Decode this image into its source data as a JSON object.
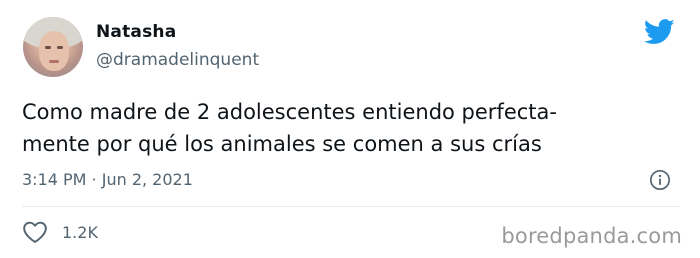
{
  "user": {
    "display_name": "Natasha",
    "handle": "@dramadelinquent",
    "avatar_icon": "profile-photo"
  },
  "tweet": {
    "text_lines": [
      "Como madre de 2 adolescentes entiendo perfecta-",
      "mente por qué los animales se comen a sus crías"
    ],
    "timestamp": "3:14 PM · Jun 2, 2021"
  },
  "actions": {
    "likes": "1.2K",
    "like_icon": "heart-icon",
    "info_icon": "info-icon"
  },
  "brand": {
    "logo_icon": "twitter-bird-icon",
    "logo_color": "#1d9bf0"
  },
  "watermark": "boredpanda.com",
  "colors": {
    "text_primary": "#0f1419",
    "text_secondary": "#536471",
    "divider": "#e6ecf0"
  }
}
